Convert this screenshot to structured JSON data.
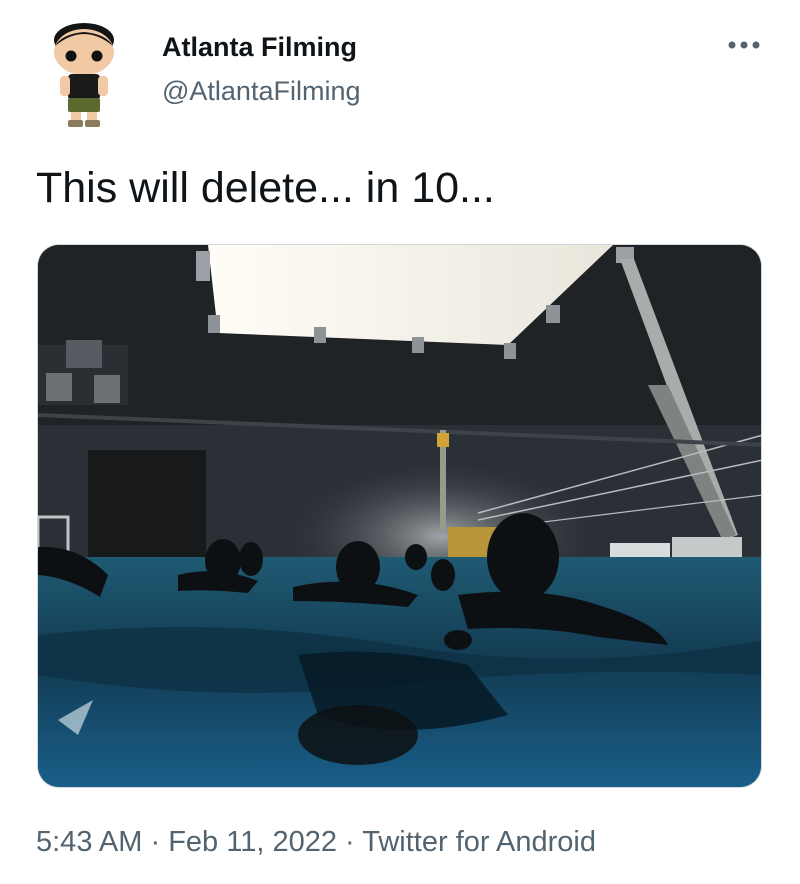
{
  "tweet": {
    "author": {
      "name": "Atlanta Filming",
      "handle": "@AtlantaFilming",
      "avatar_icon": "funko-figure-avatar"
    },
    "more_icon": "more-horizontal-icon",
    "text": "This will delete... in 10...",
    "media": {
      "type": "photo",
      "subject": "divers in an indoor film tank"
    },
    "meta": {
      "time": "5:43 AM",
      "separator": "·",
      "date": "Feb 11, 2022",
      "source": "Twitter for Android"
    }
  },
  "colors": {
    "primary_text": "#0f1419",
    "secondary_text": "#536471",
    "border": "#cfd9de",
    "water": "#1b4d66"
  }
}
